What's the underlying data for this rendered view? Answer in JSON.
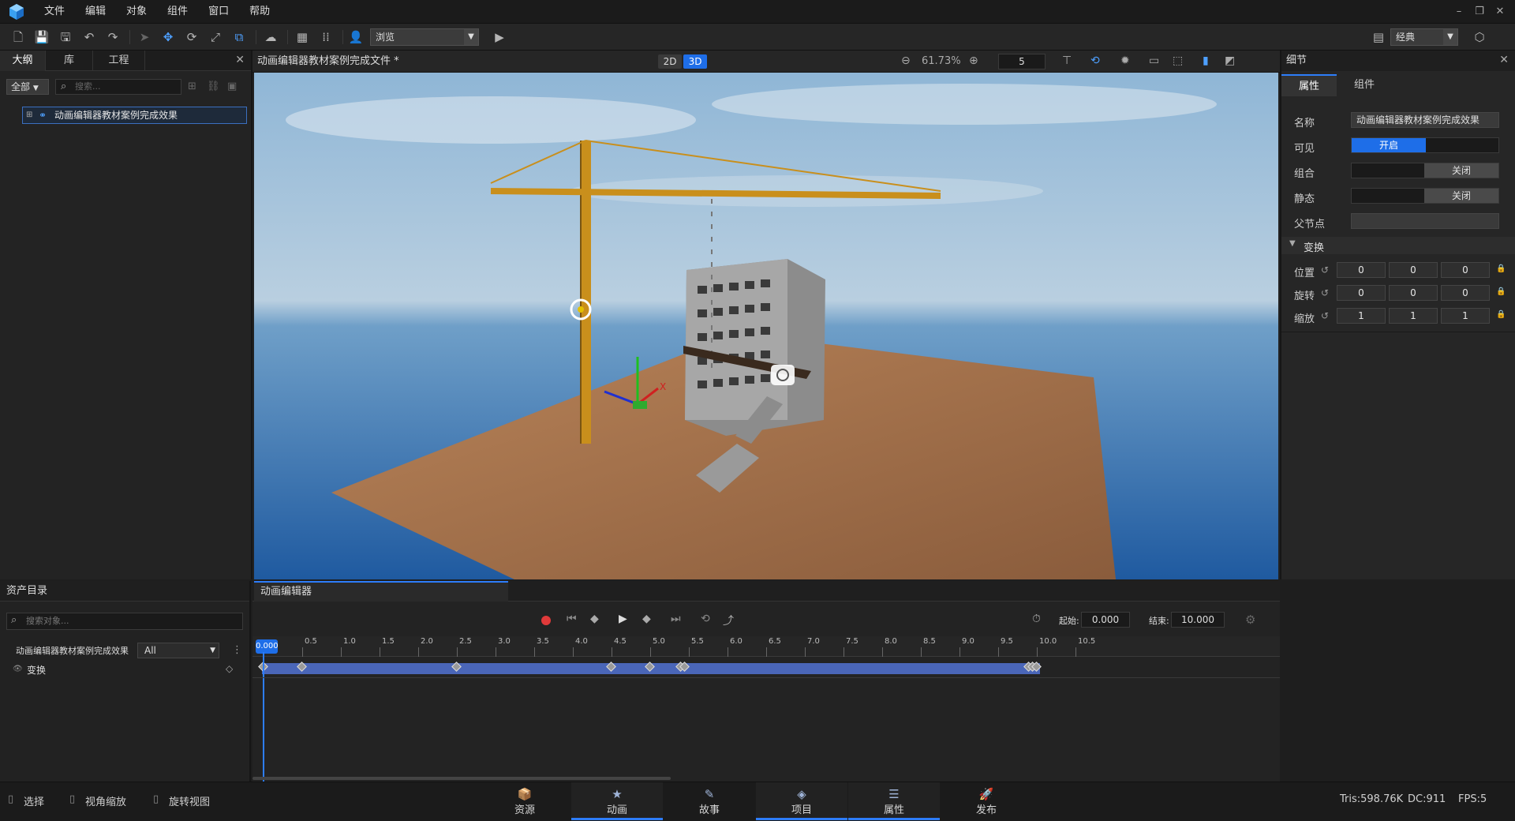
{
  "menubar": {
    "items": [
      "文件",
      "编辑",
      "对象",
      "组件",
      "窗口",
      "帮助"
    ]
  },
  "toolbar": {
    "view_mode": "浏览",
    "layout_mode": "经典"
  },
  "outline": {
    "tabs": [
      "大纲",
      "库",
      "工程"
    ],
    "filter": "全部",
    "search_placeholder": "搜索...",
    "tree_item": "动画编辑器教材案例完成效果"
  },
  "viewport": {
    "title": "动画编辑器教材案例完成文件 *",
    "mode_2d": "2D",
    "mode_3d": "3D",
    "zoom": "61.73%",
    "speed": "5"
  },
  "details": {
    "header": "细节",
    "tabs": [
      "属性",
      "组件"
    ],
    "name_label": "名称",
    "name_value": "动画编辑器教材案例完成效果",
    "visible_label": "可见",
    "visible_value": "开启",
    "group_label": "组合",
    "group_value": "关闭",
    "static_label": "静态",
    "static_value": "关闭",
    "parent_label": "父节点",
    "transform_header": "变换",
    "position_label": "位置",
    "rotation_label": "旋转",
    "scale_label": "缩放",
    "position": [
      "0",
      "0",
      "0"
    ],
    "rotation": [
      "0",
      "0",
      "0"
    ],
    "scale": [
      "1",
      "1",
      "1"
    ]
  },
  "assets": {
    "header": "资产目录",
    "search_placeholder": "搜索对象...",
    "object_name": "动画编辑器教材案例完成效果",
    "track_filter": "All",
    "track_name": "变换"
  },
  "animation": {
    "tab": "动画编辑器",
    "start_label": "起始:",
    "start_value": "0.000",
    "end_label": "结束:",
    "end_value": "10.000",
    "current_time": "0.000",
    "ticks": [
      "0.5",
      "1.0",
      "1.5",
      "2.0",
      "2.5",
      "3.0",
      "3.5",
      "4.0",
      "4.5",
      "5.0",
      "5.5",
      "6.0",
      "6.5",
      "7.0",
      "7.5",
      "8.0",
      "8.5",
      "9.0",
      "9.5",
      "10.0",
      "10.5"
    ],
    "keyframes": [
      0.0,
      0.5,
      2.5,
      4.5,
      5.0,
      5.4,
      5.45,
      9.9,
      9.95,
      10.0
    ]
  },
  "statusbar": {
    "select": "选择",
    "view_zoom": "视角缩放",
    "rotate_view": "旋转视图",
    "nav": [
      "资源",
      "动画",
      "故事",
      "项目",
      "属性",
      "发布"
    ],
    "tris": "Tris:598.76K",
    "dc": "DC:911",
    "fps": "FPS:5"
  },
  "colors": {
    "accent": "#2d7dfa",
    "record": "#e03a3a",
    "timeline_bar": "#4a66b8"
  }
}
